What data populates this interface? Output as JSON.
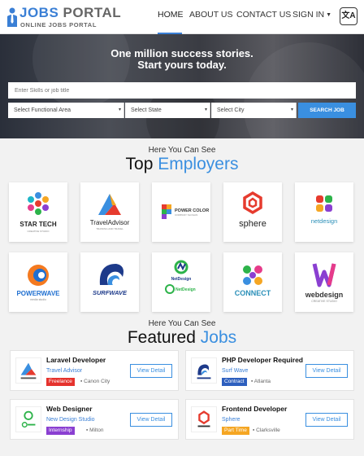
{
  "header": {
    "logo_title_1": "JOBS",
    "logo_title_2": "PORTAL",
    "logo_subtitle": "ONLINE JOBS PORTAL",
    "nav": {
      "home": "HOME",
      "about": "ABOUT US",
      "contact": "CONTACT US",
      "signin": "SIGN IN"
    },
    "language_icon": "translate-icon"
  },
  "hero": {
    "line1": "One million success stories.",
    "line2": "Start yours today.",
    "search_placeholder": "Enter Skills or job title",
    "functional_area": "Select Functional Area",
    "state": "Select State",
    "city": "Select City",
    "search_button": "SEARCH JOB"
  },
  "employers": {
    "kicker": "Here You Can See",
    "title_dark": "Top",
    "title_blue": "Employers",
    "items": [
      {
        "name": "STAR TECH",
        "tagline": "CREATIVE STUDIO"
      },
      {
        "name": "TravelAdvisor",
        "tagline": "TRAINING AND TRAVEL"
      },
      {
        "name": "POWER COLOR",
        "tagline": "COMPANY SLOGAN"
      },
      {
        "name": "sphere",
        "tagline": ""
      },
      {
        "name": "netdesign",
        "tagline": ""
      },
      {
        "name": "POWERWAVE",
        "tagline": "media studio"
      },
      {
        "name": "SURFWAVE",
        "tagline": ""
      },
      {
        "name": "NetDesign",
        "tagline": "NetDesign"
      },
      {
        "name": "CONNECT",
        "tagline": ""
      },
      {
        "name": "webdesign",
        "tagline": "CREATIVE STUDIO"
      }
    ]
  },
  "jobs": {
    "kicker": "Here You Can See",
    "title_dark": "Featured",
    "title_blue": "Jobs",
    "items": [
      {
        "title": "Laravel Developer",
        "company": "Travel Advisor",
        "type": "Freelance",
        "location": "Canon City",
        "button": "View Detail",
        "type_color": "#e5322d"
      },
      {
        "title": "PHP Developer Required",
        "company": "Surf Wave",
        "type": "Contract",
        "location": "Atlanta",
        "button": "View Detail",
        "type_color": "#2d5fbe"
      },
      {
        "title": "Web Designer",
        "company": "New Design Studio",
        "type": "Internship",
        "location": "Milton",
        "button": "View Detail",
        "type_color": "#8a3fd1"
      },
      {
        "title": "Frontend Developer",
        "company": "Sphere",
        "type": "Part Time",
        "location": "Clarksville",
        "button": "View Detail",
        "type_color": "#f5a623"
      }
    ]
  },
  "colors": {
    "accent": "#3a8fe0",
    "brand": "#3a7fd5"
  }
}
